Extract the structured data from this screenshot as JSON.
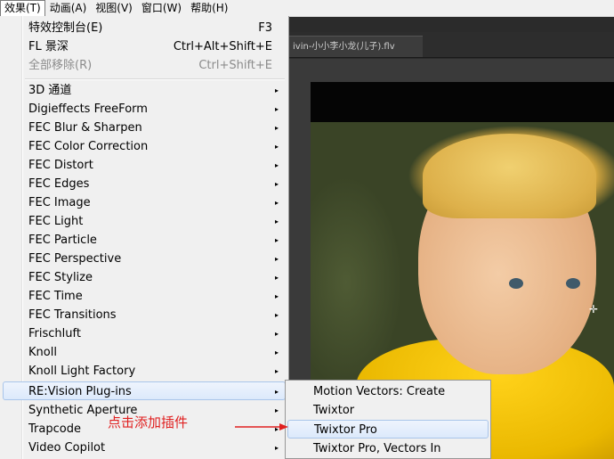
{
  "menubar": {
    "items": [
      {
        "label": "效果(T)"
      },
      {
        "label": "动画(A)"
      },
      {
        "label": "视图(V)"
      },
      {
        "label": "窗口(W)"
      },
      {
        "label": "帮助(H)"
      }
    ]
  },
  "document_tab": {
    "label": "ivin-小小李小龙(儿子).flv"
  },
  "effect_menu": {
    "top_items": [
      {
        "label": "特效控制台(E)",
        "shortcut": "F3"
      },
      {
        "label": "FL 景深",
        "shortcut": "Ctrl+Alt+Shift+E"
      },
      {
        "label": "全部移除(R)",
        "shortcut": "Ctrl+Shift+E"
      }
    ],
    "categories": [
      {
        "label": "3D 通道"
      },
      {
        "label": "Digieffects FreeForm"
      },
      {
        "label": "FEC Blur & Sharpen"
      },
      {
        "label": "FEC Color Correction"
      },
      {
        "label": "FEC Distort"
      },
      {
        "label": "FEC Edges"
      },
      {
        "label": "FEC Image"
      },
      {
        "label": "FEC Light"
      },
      {
        "label": "FEC Particle"
      },
      {
        "label": "FEC Perspective"
      },
      {
        "label": "FEC Stylize"
      },
      {
        "label": "FEC Time"
      },
      {
        "label": "FEC Transitions"
      },
      {
        "label": "Frischluft"
      },
      {
        "label": "Knoll"
      },
      {
        "label": "Knoll Light Factory"
      },
      {
        "label": "RE:Vision Plug-ins"
      },
      {
        "label": "Synthetic Aperture"
      },
      {
        "label": "Trapcode"
      },
      {
        "label": "Video Copilot"
      }
    ],
    "arrow_glyph": "▸"
  },
  "submenu": {
    "items": [
      {
        "label": "Motion Vectors: Create"
      },
      {
        "label": "Twixtor"
      },
      {
        "label": "Twixtor Pro"
      },
      {
        "label": "Twixtor Pro, Vectors In"
      }
    ]
  },
  "annotation": {
    "text": "点击添加插件",
    "color": "#e02020"
  },
  "colors": {
    "menu_bg": "#f0f0f0",
    "highlight_border": "#a9c5ea",
    "app_bg": "#2b2b2b"
  }
}
